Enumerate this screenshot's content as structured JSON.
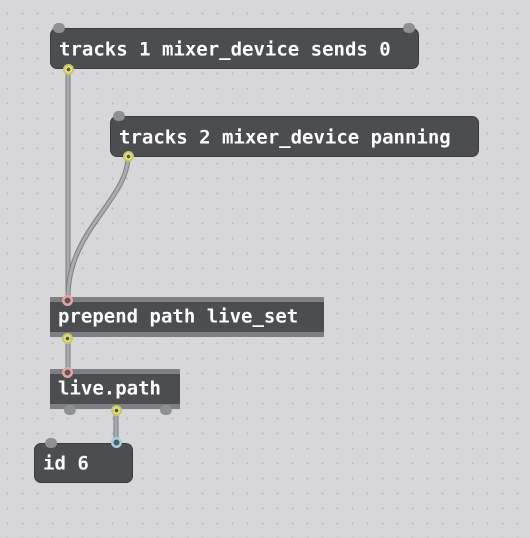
{
  "patcher": {
    "objects": [
      {
        "kind": "message",
        "text": "tracks 1 mixer_device sends 0"
      },
      {
        "kind": "message",
        "text": "tracks 2 mixer_device panning"
      },
      {
        "kind": "object",
        "text": "prepend path live_set"
      },
      {
        "kind": "object",
        "text": "live.path"
      },
      {
        "kind": "message",
        "text": "id 6"
      }
    ]
  },
  "colors": {
    "canvas": "#d7d7d9",
    "box": "#4b4d50",
    "box_border": "#7d7f82",
    "text": "#ffffff",
    "cord": "#9a9b9d",
    "outlet_message": "#e6e486",
    "inlet_connected": "#e7a4a0",
    "outlet_id": "#9ed1e6"
  },
  "connections": [
    {
      "from": "tracks 1 mixer_device sends 0",
      "to": "prepend path live_set"
    },
    {
      "from": "tracks 2 mixer_device panning",
      "to": "prepend path live_set"
    },
    {
      "from": "prepend path live_set",
      "to": "live.path"
    },
    {
      "from": "live.path",
      "to": "id 6"
    }
  ]
}
